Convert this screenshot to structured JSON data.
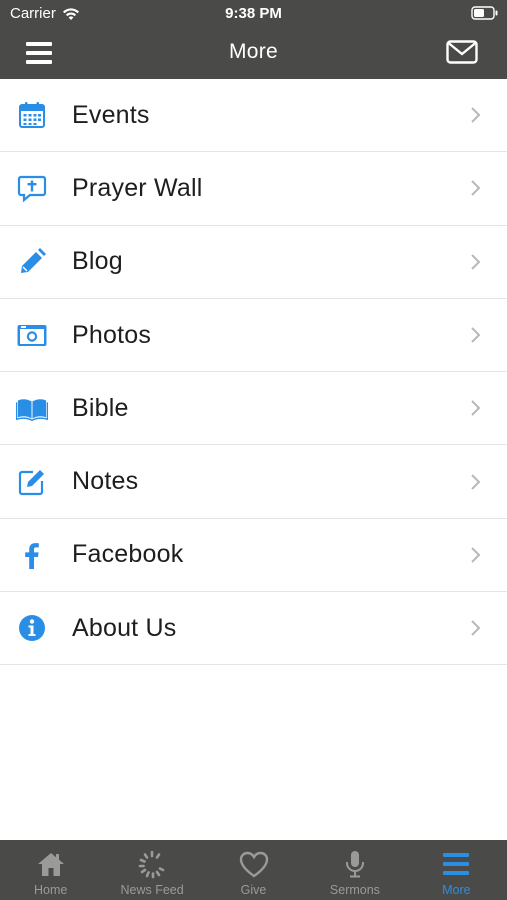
{
  "status_bar": {
    "carrier": "Carrier",
    "time": "9:38 PM"
  },
  "header": {
    "title": "More",
    "menu_icon": "hamburger-icon",
    "mail_icon": "mail-icon"
  },
  "menu_items": [
    {
      "label": "Events",
      "icon": "calendar-icon"
    },
    {
      "label": "Prayer Wall",
      "icon": "prayer-bubble-icon"
    },
    {
      "label": "Blog",
      "icon": "pencil-icon"
    },
    {
      "label": "Photos",
      "icon": "camera-icon"
    },
    {
      "label": "Bible",
      "icon": "book-icon"
    },
    {
      "label": "Notes",
      "icon": "notes-icon"
    },
    {
      "label": "Facebook",
      "icon": "facebook-icon"
    },
    {
      "label": "About Us",
      "icon": "info-icon"
    }
  ],
  "tabs": [
    {
      "label": "Home",
      "icon": "home-icon",
      "active": false
    },
    {
      "label": "News Feed",
      "icon": "refresh-icon",
      "active": false
    },
    {
      "label": "Give",
      "icon": "heart-icon",
      "active": false
    },
    {
      "label": "Sermons",
      "icon": "microphone-icon",
      "active": false
    },
    {
      "label": "More",
      "icon": "menu-icon",
      "active": true
    }
  ],
  "colors": {
    "bar": "#4a4a48",
    "accent": "#2b8ee6",
    "inactive_tab": "#9a9a98",
    "text": "#1e1e1e"
  }
}
